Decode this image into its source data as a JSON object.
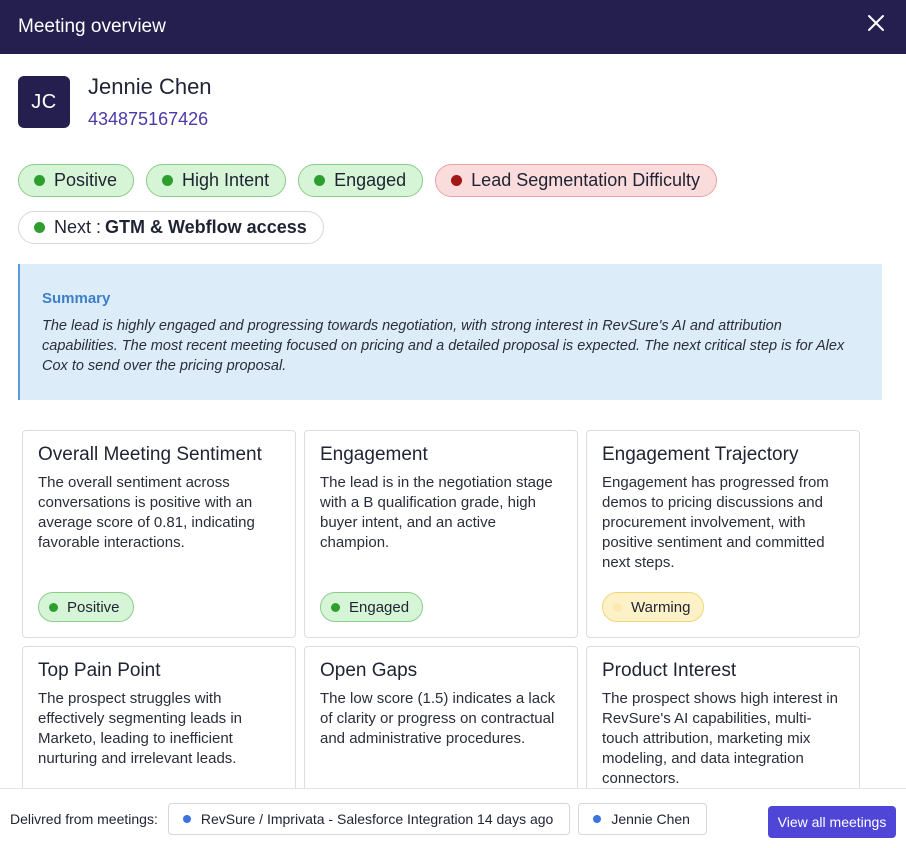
{
  "header": {
    "title": "Meeting overview",
    "close_icon": "close-icon"
  },
  "lead": {
    "initials": "JC",
    "name": "Jennie Chen",
    "id": "434875167426"
  },
  "tags": [
    {
      "label": "Positive",
      "tone": "green"
    },
    {
      "label": "High Intent",
      "tone": "green"
    },
    {
      "label": "Engaged",
      "tone": "green"
    },
    {
      "label": "Lead Segmentation Difficulty",
      "tone": "red"
    }
  ],
  "next_step": {
    "prefix": "Next :",
    "value": "GTM & Webflow access"
  },
  "summary": {
    "title": "Summary",
    "text": "The lead is highly engaged and progressing towards negotiation, with strong interest in RevSure's AI and attribution capabilities. The most recent meeting focused on pricing and a detailed proposal is expected. The next critical step is for Alex Cox to send over the pricing proposal."
  },
  "cards": [
    {
      "title": "Overall Meeting Sentiment",
      "text": "The overall sentiment across conversations is positive with an average score of 0.81, indicating favorable interactions.",
      "badge": "Positive",
      "badge_tone": "green"
    },
    {
      "title": "Engagement",
      "text": "The lead is in the negotiation stage with a B qualification grade, high buyer intent, and an active champion.",
      "badge": "Engaged",
      "badge_tone": "green"
    },
    {
      "title": "Engagement Trajectory",
      "text": "Engagement has progressed from demos to pricing discussions and procurement involvement, with positive sentiment and committed next steps.",
      "badge": "Warming",
      "badge_tone": "yellow"
    },
    {
      "title": "Top Pain Point",
      "text": "The prospect struggles with effectively segmenting leads in Marketo, leading to inefficient nurturing and irrelevant leads."
    },
    {
      "title": "Open Gaps",
      "text": "The low score (1.5) indicates a lack of clarity or progress on contractual and administrative procedures."
    },
    {
      "title": "Product Interest",
      "text": "The prospect shows high interest in RevSure's AI capabilities, multi-touch attribution, marketing mix modeling, and data integration connectors."
    }
  ],
  "footer": {
    "label": "Delivred from meetings:",
    "meetings": [
      "RevSure / Imprivata - Salesforce Integration 14 days ago",
      "Jennie Chen"
    ],
    "view_all_label": "View all meetings"
  },
  "colors": {
    "header_bg": "#241f4f",
    "accent": "#4f46d8",
    "lead_id": "#4a3aa8",
    "positive": "#2e9e2e",
    "negative": "#a31717",
    "summary_bg": "#dcedf9"
  }
}
